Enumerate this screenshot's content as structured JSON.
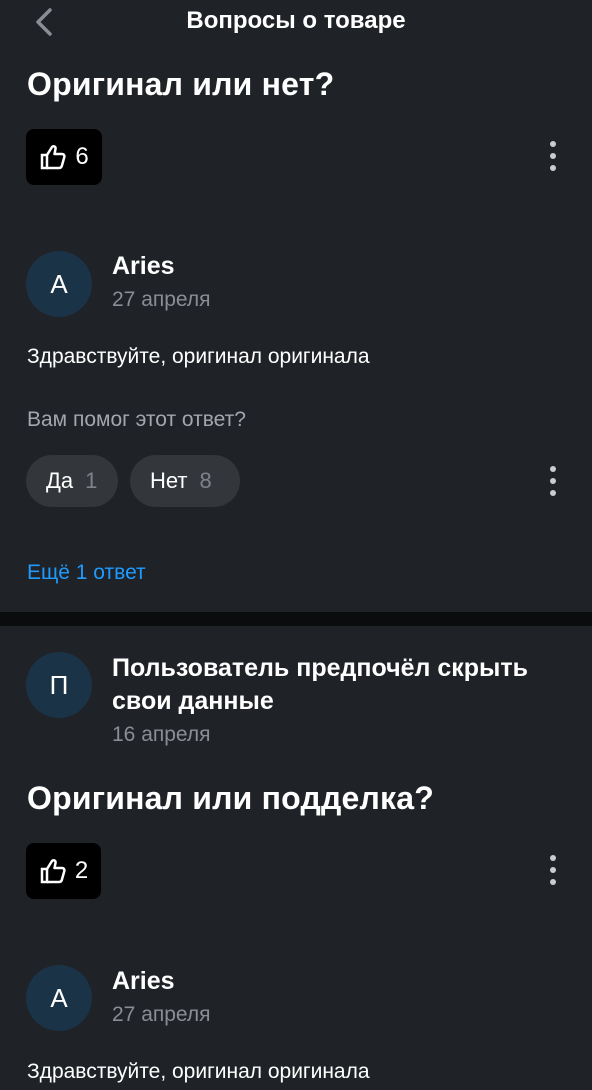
{
  "header": {
    "title": "Вопросы о товаре"
  },
  "question1": {
    "title": "Оригинал или нет?",
    "likes": "6",
    "answer": {
      "avatar_letter": "А",
      "author": "Aries",
      "date": "27 апреля",
      "text": "Здравствуйте, оригинал оригинала",
      "helpful_question": "Вам помог этот ответ?",
      "yes_label": "Да",
      "yes_count": "1",
      "no_label": "Нет",
      "no_count": "8"
    },
    "more_answers": "Ещё 1 ответ"
  },
  "question2": {
    "asker": {
      "avatar_letter": "П",
      "name_line1": "Пользователь предпочёл скрыть",
      "name_line2": "свои данные",
      "date": "16 апреля"
    },
    "title": "Оригинал или подделка?",
    "likes": "2",
    "answer": {
      "avatar_letter": "А",
      "author": "Aries",
      "date": "27 апреля",
      "text": "Здравствуйте, оригинал оригинала"
    }
  },
  "icons": {
    "back": "chevron-left-icon",
    "like": "thumbs-up-icon",
    "more": "more-vertical-icon"
  },
  "colors": {
    "background": "#1f2227",
    "like_button_bg": "#000000",
    "avatar_bg": "#1b3347",
    "link": "#1e9bff",
    "divider": "#0b0c0e",
    "vote_pill_bg": "#33363b"
  }
}
